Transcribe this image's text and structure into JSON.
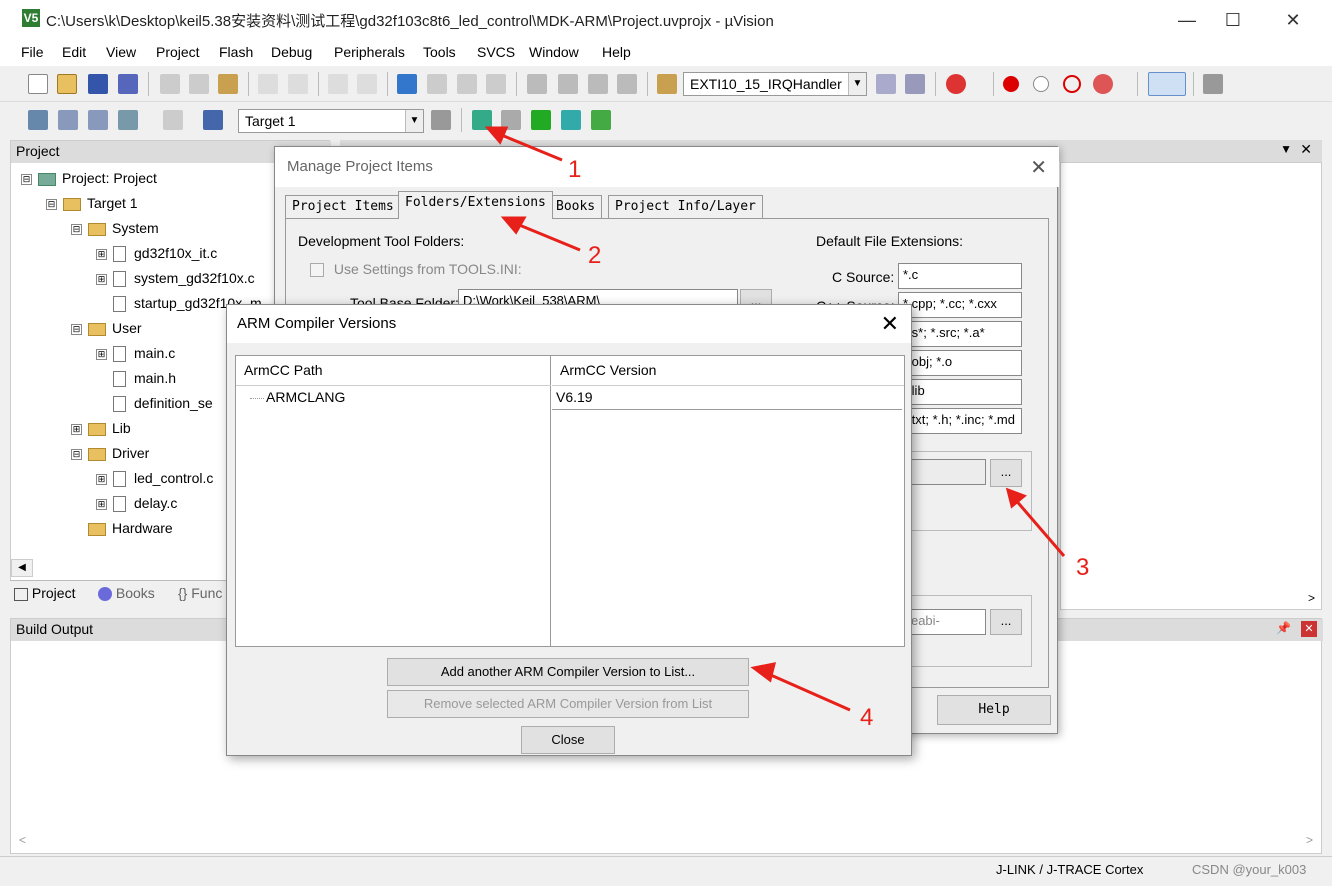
{
  "window": {
    "title": "C:\\Users\\k\\Desktop\\keil5.38安装资料\\测试工程\\gd32f103c8t6_led_control\\MDK-ARM\\Project.uvprojx - µVision",
    "app_icon": "V5",
    "minimize": "—",
    "maximize": "☐",
    "close": "✕"
  },
  "menu": [
    "File",
    "Edit",
    "View",
    "Project",
    "Flash",
    "Debug",
    "Peripherals",
    "Tools",
    "SVCS",
    "Window",
    "Help"
  ],
  "toolbar": {
    "function_combo": "EXTI10_15_IRQHandler",
    "target_combo": "Target 1"
  },
  "project_panel": {
    "header": "Project",
    "tree": [
      {
        "label": "Project: Project",
        "level": 0,
        "kind": "root",
        "expander": "⊟"
      },
      {
        "label": "Target 1",
        "level": 1,
        "kind": "target",
        "expander": "⊟"
      },
      {
        "label": "System",
        "level": 2,
        "kind": "folder",
        "expander": "⊟"
      },
      {
        "label": "gd32f10x_it.c",
        "level": 3,
        "kind": "file",
        "expander": "⊞"
      },
      {
        "label": "system_gd32f10x.c",
        "level": 3,
        "kind": "file",
        "expander": "⊞"
      },
      {
        "label": "startup_gd32f10x_m",
        "level": 3,
        "kind": "file",
        "expander": ""
      },
      {
        "label": "User",
        "level": 2,
        "kind": "folder",
        "expander": "⊟"
      },
      {
        "label": "main.c",
        "level": 3,
        "kind": "file",
        "expander": "⊞"
      },
      {
        "label": "main.h",
        "level": 3,
        "kind": "file",
        "expander": ""
      },
      {
        "label": "definition_se",
        "level": 3,
        "kind": "file",
        "expander": ""
      },
      {
        "label": "Lib",
        "level": 2,
        "kind": "folder",
        "expander": "⊞"
      },
      {
        "label": "Driver",
        "level": 2,
        "kind": "folder",
        "expander": "⊟"
      },
      {
        "label": "led_control.c",
        "level": 3,
        "kind": "file",
        "expander": "⊞"
      },
      {
        "label": "delay.c",
        "level": 3,
        "kind": "file",
        "expander": "⊞"
      },
      {
        "label": "Hardware",
        "level": 2,
        "kind": "folder",
        "expander": ""
      }
    ],
    "tabs": [
      "Project",
      "Books",
      "{} Func"
    ]
  },
  "build_output": {
    "header": "Build Output"
  },
  "status_bar": {
    "debugger": "J-LINK / J-TRACE Cortex",
    "watermark": "CSDN @your_k003"
  },
  "manage_dialog": {
    "title": "Manage Project Items",
    "tabs": [
      "Project Items",
      "Folders/Extensions",
      "Books",
      "Project Info/Layer"
    ],
    "active_tab": "Folders/Extensions",
    "dev_tool_folders_label": "Development Tool Folders:",
    "use_settings_label": "Use Settings from TOOLS.INI:",
    "tool_base_label": "Tool Base Folder:",
    "tool_base_value": "D:\\Work\\Keil_538\\ARM\\",
    "default_ext_label": "Default File Extensions:",
    "c_source_label": "C Source:",
    "c_source_value": "*.c",
    "cpp_source_label": "C++ Source:",
    "cpp_source_value": "*.cpp; *.cc; *.cxx",
    "asm_value": "*.s*; *.src; *.a*",
    "obj_value": "*.obj; *.o",
    "lib_value": "*.lib",
    "doc_value": "*.txt; *.h; *.inc; *.md",
    "gcc_value": "arm-none-eabi-",
    "browse": "...",
    "help_button": "Help"
  },
  "arm_dialog": {
    "title": "ARM Compiler Versions",
    "col_path": "ArmCC Path",
    "col_version": "ArmCC Version",
    "rows": [
      {
        "path": "ARMCLANG",
        "version": "V6.19"
      }
    ],
    "add_button": "Add another ARM Compiler Version to List...",
    "remove_button": "Remove selected ARM Compiler Version from List",
    "close_button": "Close"
  },
  "annotations": {
    "labels": [
      "1",
      "2",
      "3",
      "4"
    ],
    "color": "#e8201a"
  },
  "colors": {
    "accent_red": "#e8201a",
    "folder": "#e8c060"
  }
}
